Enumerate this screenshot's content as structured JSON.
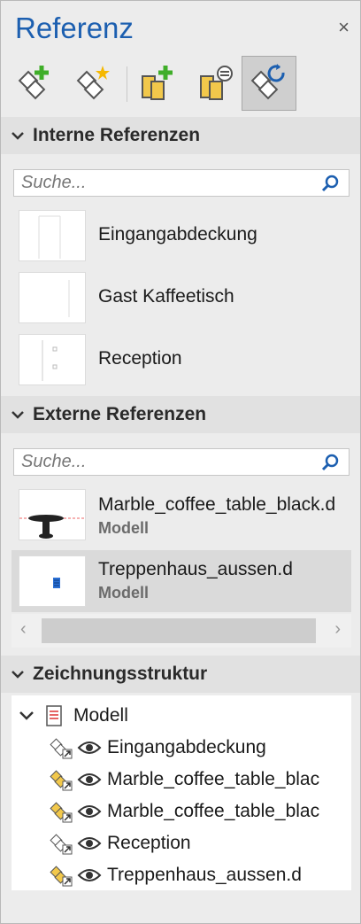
{
  "panel": {
    "title": "Referenz",
    "close_glyph": "×"
  },
  "toolbar": {
    "buttons": [
      {
        "icon": "add-block-icon"
      },
      {
        "icon": "new-block-icon"
      },
      {
        "icon": "add-external-icon"
      },
      {
        "icon": "manage-external-icon"
      },
      {
        "icon": "reload-block-icon",
        "active": true
      }
    ]
  },
  "internal": {
    "heading": "Interne Referenzen",
    "search_placeholder": "Suche...",
    "items": [
      {
        "label": "Eingangabdeckung"
      },
      {
        "label": "Gast Kaffeetisch"
      },
      {
        "label": "Reception"
      }
    ]
  },
  "external": {
    "heading": "Externe Referenzen",
    "search_placeholder": "Suche...",
    "items": [
      {
        "name": "Marble_coffee_table_black.d",
        "type": "Modell"
      },
      {
        "name": "Treppenhaus_aussen.d",
        "type": "Modell",
        "selected": true
      }
    ]
  },
  "structure": {
    "heading": "Zeichnungsstruktur",
    "root": "Modell",
    "children": [
      {
        "label": "Eingangabdeckung",
        "kind": "internal"
      },
      {
        "label": "Marble_coffee_table_blac",
        "kind": "external"
      },
      {
        "label": "Marble_coffee_table_blac",
        "kind": "external"
      },
      {
        "label": "Reception",
        "kind": "internal"
      },
      {
        "label": "Treppenhaus_aussen.d",
        "kind": "external"
      }
    ]
  },
  "colors": {
    "accent": "#1c5fb0",
    "plus_green": "#3fae29",
    "folder_yellow": "#f2c84b"
  }
}
